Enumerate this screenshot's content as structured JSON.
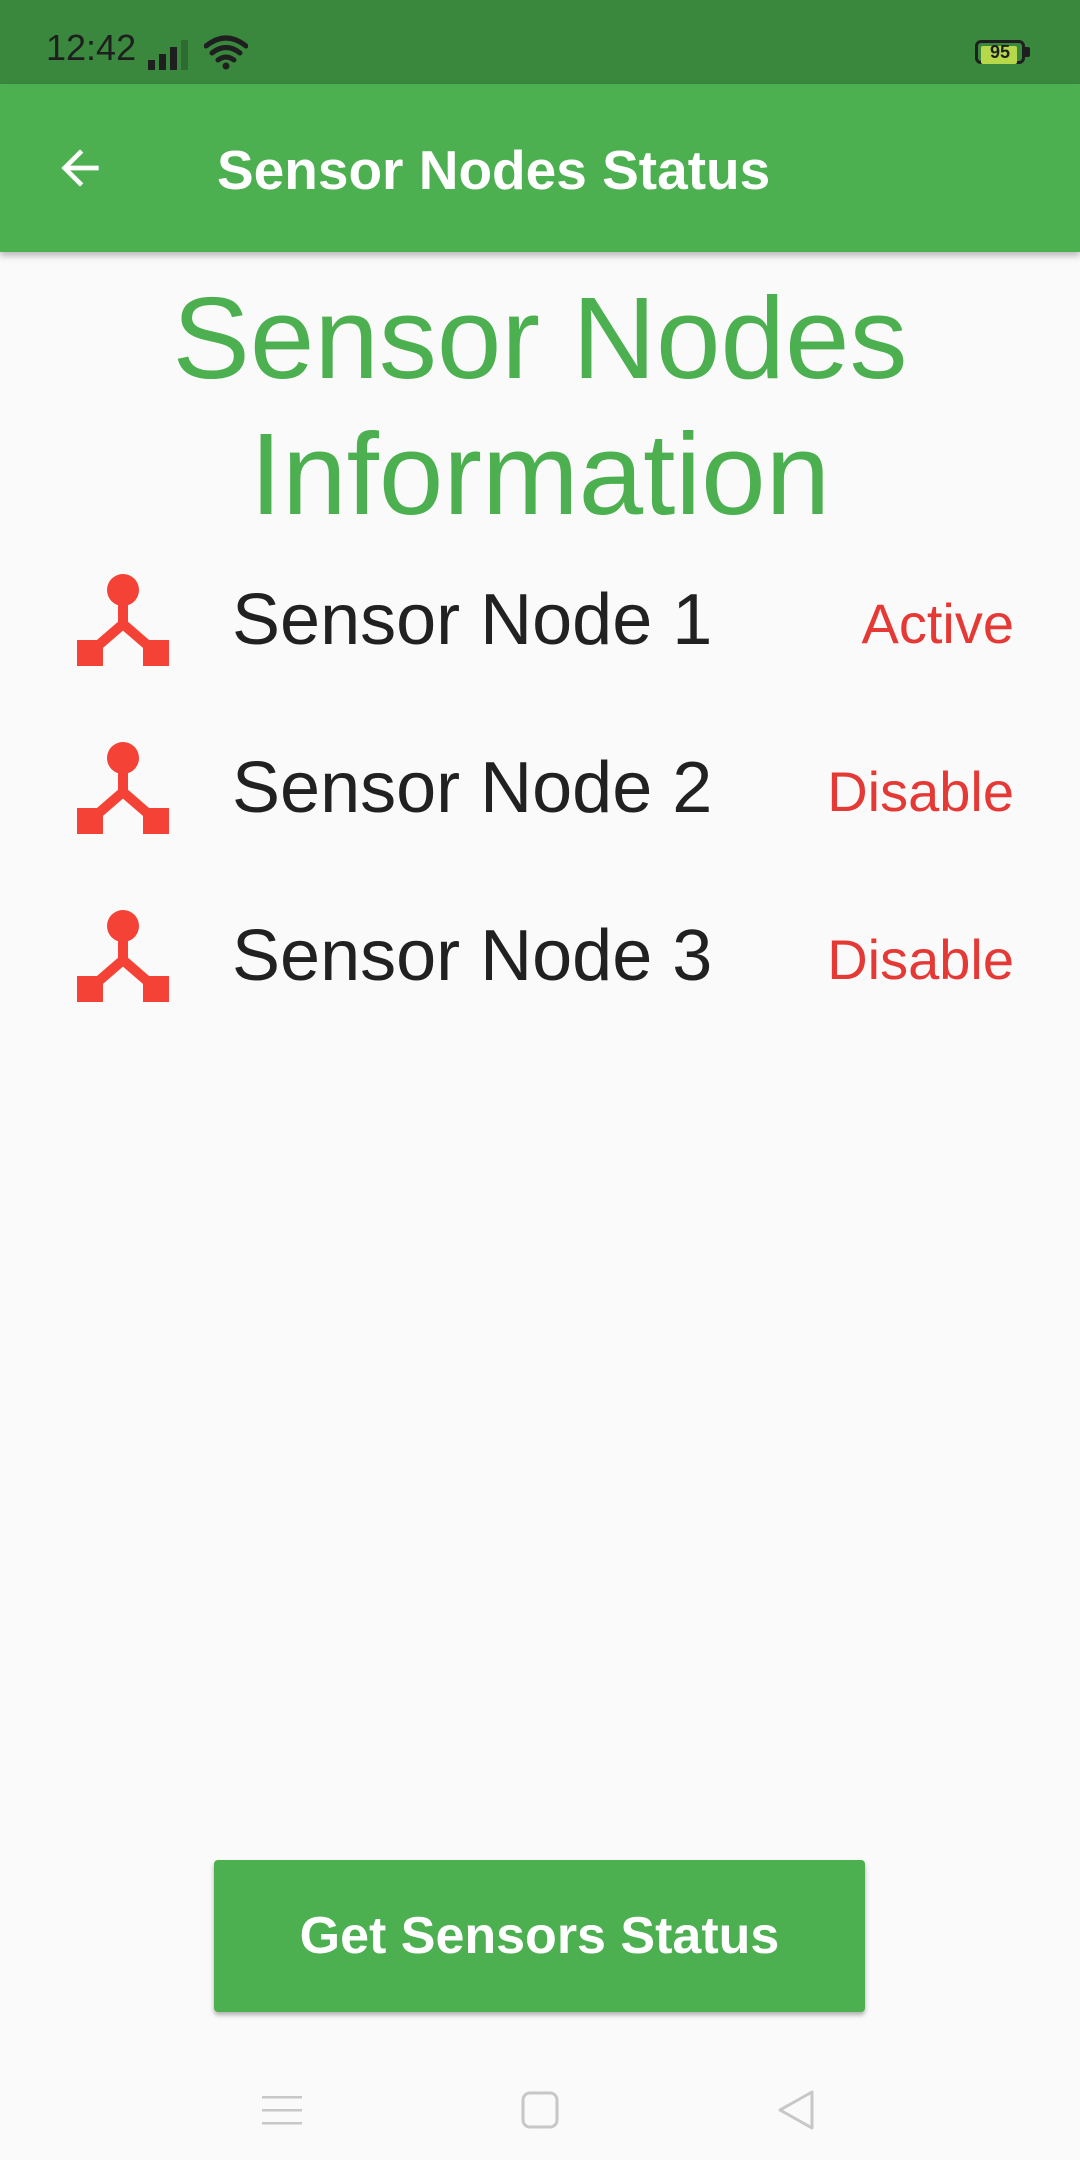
{
  "status_bar": {
    "time": "12:42",
    "battery_level": "95",
    "battery_fraction": 0.95,
    "icons": [
      "signal-icon",
      "wifi-icon",
      "battery-icon"
    ]
  },
  "app_bar": {
    "title": "Sensor Nodes Status",
    "back_icon": "arrow-back-icon",
    "background_color": "#4caf50"
  },
  "heading": {
    "line1": "Sensor Nodes",
    "line2": "Information",
    "color": "#4caf50"
  },
  "sensors": [
    {
      "name": "Sensor Node 1",
      "status": "Active",
      "icon": "sensor-node-icon"
    },
    {
      "name": "Sensor Node 2",
      "status": "Disable",
      "icon": "sensor-node-icon"
    },
    {
      "name": "Sensor Node 3",
      "status": "Disable",
      "icon": "sensor-node-icon"
    }
  ],
  "status_color": "#e53935",
  "actions": {
    "get_status_label": "Get Sensors Status"
  },
  "nav_bar": {
    "icons": [
      "menu-icon",
      "home-square-icon",
      "back-triangle-icon"
    ]
  }
}
